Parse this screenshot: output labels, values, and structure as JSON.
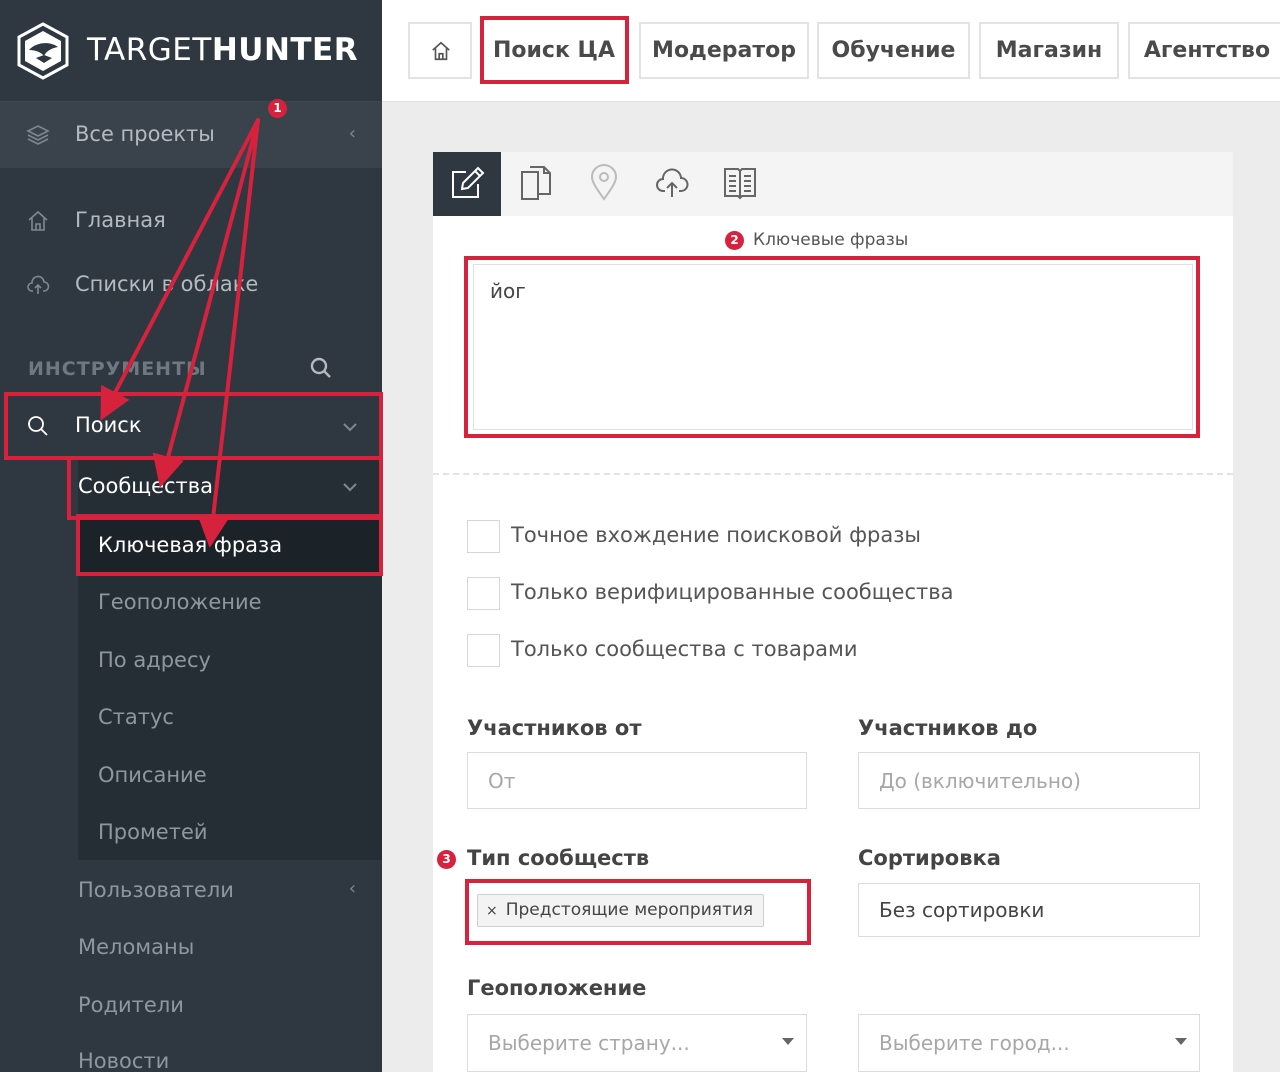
{
  "brand": {
    "name_light": "TARGET",
    "name_bold": "HUNTER"
  },
  "sidebar": {
    "projects_label": "Все проекты",
    "home_label": "Главная",
    "cloud_label": "Списки в облаке",
    "section_tools": "ИНСТРУМЕНТЫ",
    "search_label": "Поиск",
    "communities_label": "Сообщества",
    "community_items": [
      "Ключевая фраза",
      "Геоположение",
      "По адресу",
      "Статус",
      "Описание",
      "Прометей"
    ],
    "users_label": "Пользователи",
    "lower_items": [
      "Меломаны",
      "Родители",
      "Новости"
    ]
  },
  "topnav": {
    "tabs": [
      "Поиск ЦА",
      "Модератор",
      "Обучение",
      "Магазин",
      "Агентство"
    ]
  },
  "form": {
    "keywords_label": "Ключевые фразы",
    "keywords_value": "йог",
    "checkboxes": [
      "Точное вхождение поисковой фразы",
      "Только верифицированные сообщества",
      "Только сообщества с товарами"
    ],
    "members_from_label": "Участников от",
    "members_from_placeholder": "От",
    "members_to_label": "Участников до",
    "members_to_placeholder": "До (включительно)",
    "community_type_label": "Тип сообществ",
    "community_type_tag": "Предстоящие мероприятия",
    "tag_remove": "×",
    "sort_label": "Сортировка",
    "sort_value": "Без сортировки",
    "geo_label": "Геоположение",
    "country_placeholder": "Выберите страну...",
    "city_placeholder": "Выберите город..."
  },
  "annotations": {
    "badge_1": "1",
    "badge_2": "2",
    "badge_3": "3",
    "color": "#d7223e"
  }
}
